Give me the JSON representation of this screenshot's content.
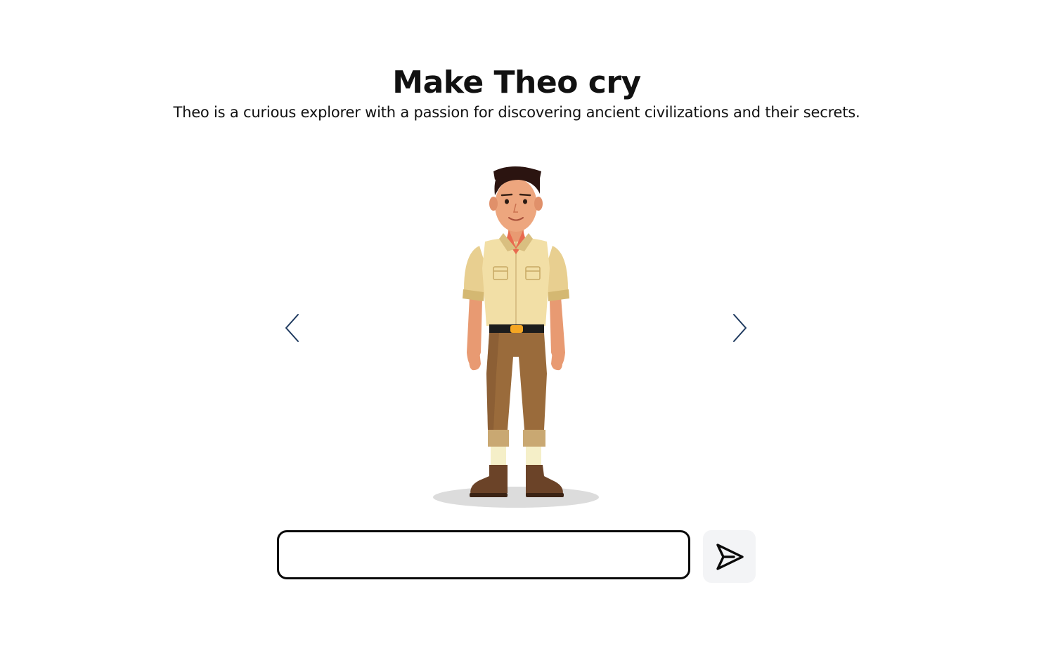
{
  "header": {
    "title": "Make Theo cry",
    "subtitle": "Theo is a curious explorer with a passion for discovering ancient civilizations and their secrets."
  },
  "carousel": {
    "prev_icon": "chevron-left-icon",
    "next_icon": "chevron-right-icon",
    "arrow_color": "#1f3a5f"
  },
  "character": {
    "name": "Theo"
  },
  "chat": {
    "input_value": "",
    "input_placeholder": "",
    "send_icon": "paper-plane-icon",
    "send_button_bg": "#f3f4f6"
  }
}
